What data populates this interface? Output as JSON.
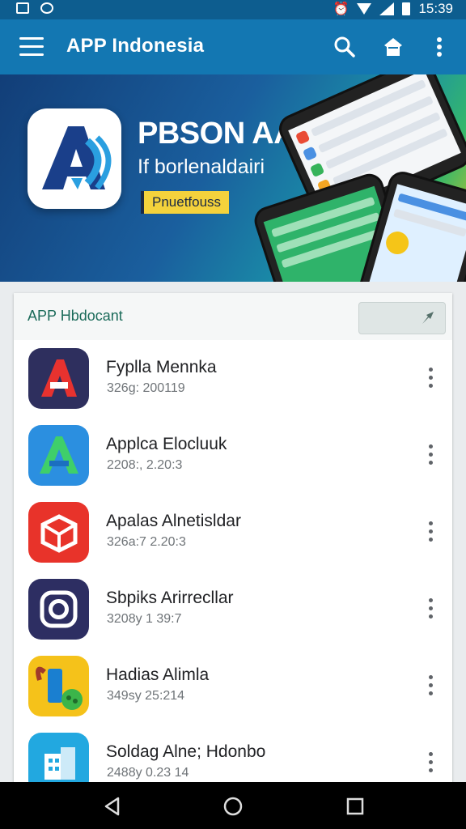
{
  "status_bar": {
    "time": "15:39",
    "icons": [
      "screenshot-icon",
      "shield-icon",
      "alarm-icon",
      "wifi-icon",
      "signal-icon",
      "battery-icon"
    ]
  },
  "app_bar": {
    "title": "APP Indonesia",
    "icons": [
      "menu-icon",
      "search-icon",
      "store-icon",
      "more-vert-icon"
    ],
    "color": "#1377b2"
  },
  "banner": {
    "title": "PBSON AAPK",
    "subtitle": "If borlenaldairi",
    "tag": "Pnuetfouss"
  },
  "section": {
    "title": "APP Hbdocant",
    "action_icon": "pin-icon"
  },
  "apps": [
    {
      "name": "Fyplla Mennka",
      "meta": "326g: 200119",
      "icon": "letter-a-red-icon"
    },
    {
      "name": "Applca Elocluuk",
      "meta": "2208:, 2.20:3",
      "icon": "letter-a-green-icon"
    },
    {
      "name": "Apalas Alnetisldar",
      "meta": "326a:7 2.20:3",
      "icon": "cube-icon"
    },
    {
      "name": "Sbpiks Arirrecllar",
      "meta": "3208y 1 39:7",
      "icon": "instagram-camera-icon"
    },
    {
      "name": "Hadias Alimla",
      "meta": "349sy 25:214",
      "icon": "brush-icon"
    },
    {
      "name": "Soldag Alne; Hdonbo",
      "meta": "2488y 0.23 14",
      "icon": "building-icon"
    }
  ],
  "nav_bar": {
    "icons": [
      "back-icon",
      "home-icon",
      "recents-icon"
    ]
  }
}
